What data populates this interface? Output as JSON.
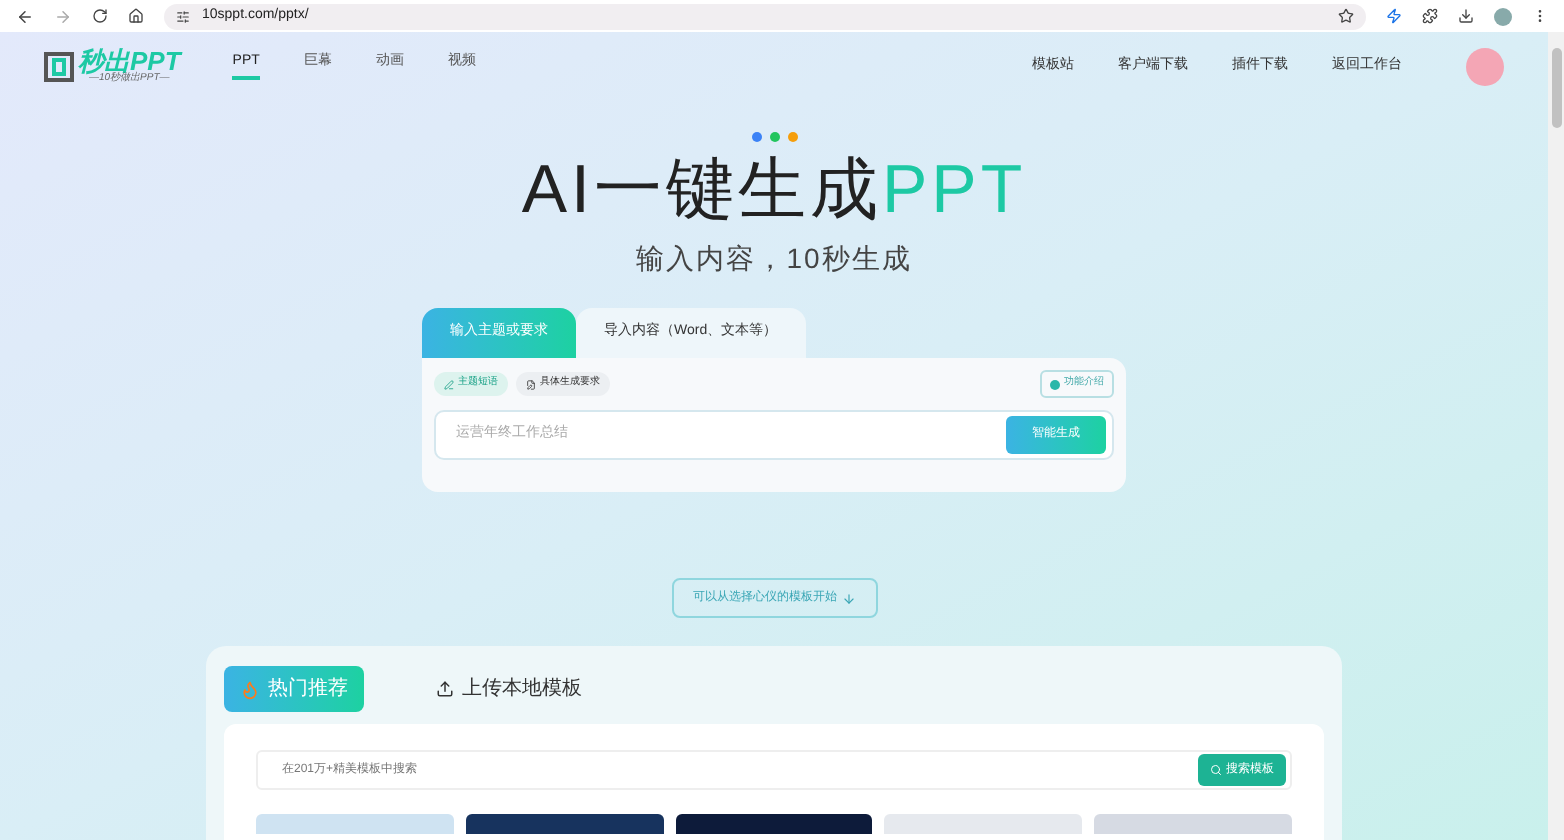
{
  "browser": {
    "url": "10sppt.com/pptx/"
  },
  "logo": {
    "name": "秒出PPT",
    "tagline": "—10秒做出PPT—"
  },
  "nav": [
    {
      "label": "PPT",
      "selected": true
    },
    {
      "label": "巨幕",
      "selected": false
    },
    {
      "label": "动画",
      "selected": false
    },
    {
      "label": "视频",
      "selected": false
    }
  ],
  "nav_right": [
    "模板站",
    "客户端下载",
    "插件下载",
    "返回工作台"
  ],
  "hero": {
    "title_prefix": "AI一键生成",
    "title_accent": "PPT",
    "subtitle": "输入内容，10秒生成"
  },
  "generator": {
    "tabs": [
      {
        "label": "输入主题或要求",
        "selected": true
      },
      {
        "label": "导入内容（Word、文本等）",
        "selected": false
      }
    ],
    "modes": [
      {
        "label": "主题短语",
        "selected": true
      },
      {
        "label": "具体生成要求",
        "selected": false
      }
    ],
    "help": "功能介绍",
    "placeholder": "运营年终工作总结",
    "button": "智能生成"
  },
  "template_hint": "可以从选择心仪的模板开始",
  "templates": {
    "tabs": [
      {
        "label": "热门推荐",
        "selected": true,
        "kind": "hot"
      },
      {
        "label": "上传本地模板",
        "selected": false,
        "kind": "upload"
      }
    ],
    "search_placeholder": "在201万+精美模板中搜索",
    "search_button": "搜索模板"
  }
}
